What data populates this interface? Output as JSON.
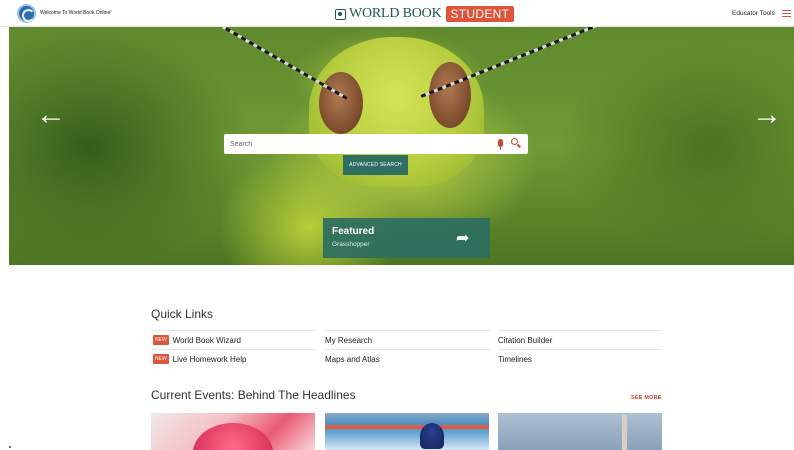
{
  "header": {
    "welcome_text": "Welcome To World Book Online!",
    "brand_name": "WORLD BOOK",
    "brand_badge": "STUDENT",
    "educator_tools": "Educator Tools"
  },
  "hero": {
    "search_placeholder": "Search",
    "advanced_search_label": "ADVANCED SEARCH",
    "featured_title": "Featured",
    "featured_subtitle": "Grasshopper"
  },
  "quick_links": {
    "title": "Quick Links",
    "new_badge": "NEW",
    "items": [
      {
        "label": "World Book Wizard",
        "is_new": true
      },
      {
        "label": "My Research",
        "is_new": false
      },
      {
        "label": "Citation Builder",
        "is_new": false
      },
      {
        "label": "Live Homework Help",
        "is_new": true
      },
      {
        "label": "Maps and Atlas",
        "is_new": false
      },
      {
        "label": "Timelines",
        "is_new": false
      }
    ]
  },
  "current_events": {
    "title": "Current Events: Behind The Headlines",
    "see_more": "SEE MORE"
  },
  "colors": {
    "accent": "#e0553a",
    "brand_green": "#1f5b4e",
    "featured_green": "#2d6e5f"
  }
}
